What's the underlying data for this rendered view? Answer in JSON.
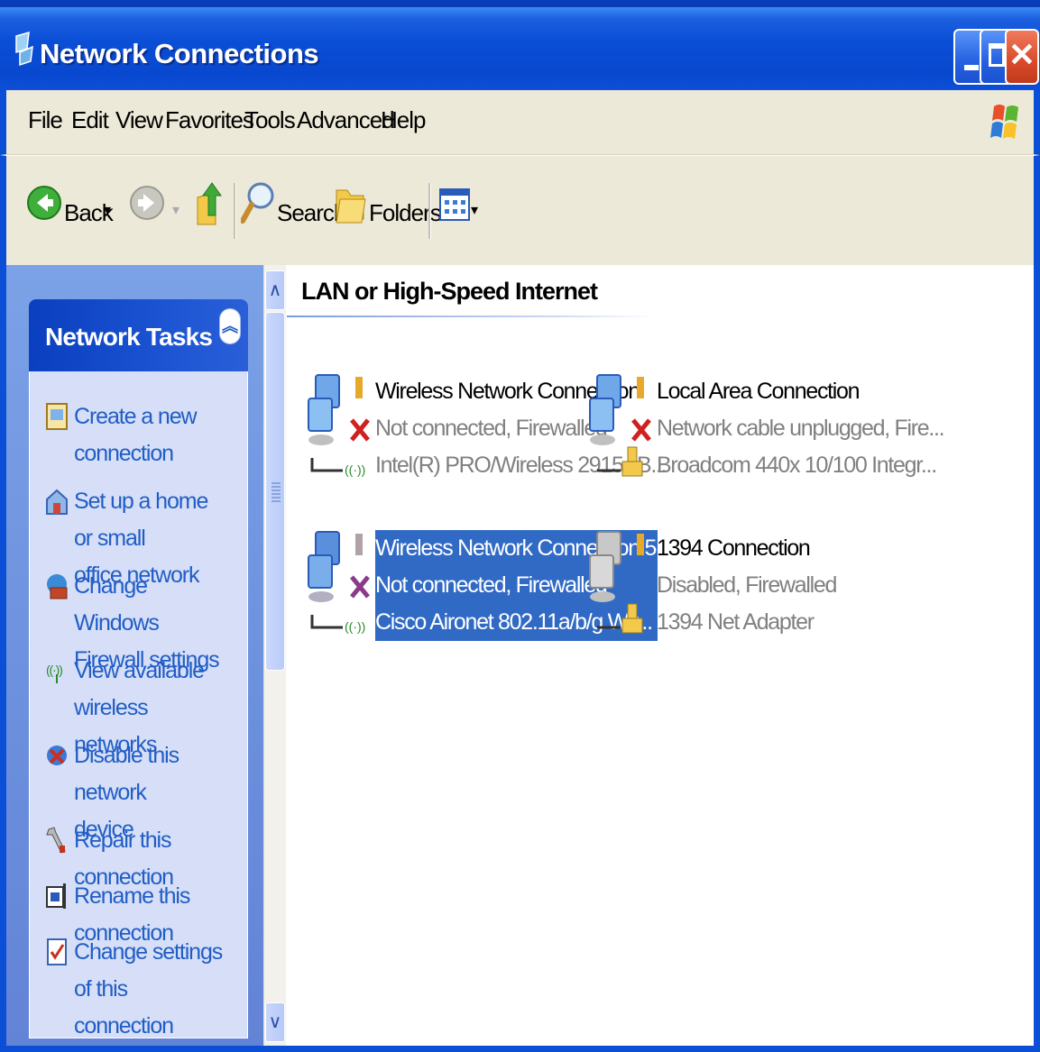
{
  "window": {
    "title": "Network Connections"
  },
  "menu": {
    "items": [
      "File",
      "Edit",
      "View",
      "Favorites",
      "Tools",
      "Advanced",
      "Help"
    ]
  },
  "toolbar": {
    "back_label": "Back",
    "search_label": "Search",
    "folders_label": "Folders"
  },
  "task_pane": {
    "title": "Network Tasks",
    "tasks": [
      {
        "line1": "Create a new",
        "line2": "connection",
        "icon": "new-connection-icon"
      },
      {
        "line1": "Set up a home or small",
        "line2": "office network",
        "icon": "home-network-icon"
      },
      {
        "line1": "Change Windows",
        "line2": "Firewall settings",
        "icon": "firewall-icon"
      },
      {
        "line1": "View available wireless",
        "line2": "networks",
        "icon": "wireless-icon"
      },
      {
        "line1": "Disable this network",
        "line2": "device",
        "icon": "disable-network-icon"
      },
      {
        "line1": "Repair this connection",
        "line2": "",
        "icon": "repair-icon"
      },
      {
        "line1": "Rename this connection",
        "line2": "",
        "icon": "rename-icon"
      },
      {
        "line1": "Change settings of this",
        "line2": "connection",
        "icon": "settings-icon"
      }
    ]
  },
  "content": {
    "group_title": "LAN or High-Speed Internet",
    "connections": [
      {
        "name": "Wireless Network Connection",
        "status": "Not connected, Firewalled",
        "device": "Intel(R) PRO/Wireless 2915AB...",
        "type": "wireless",
        "state": "disconnected",
        "selected": false
      },
      {
        "name": "Local Area Connection",
        "status": "Network cable unplugged, Fire...",
        "device": "Broadcom 440x 10/100 Integr...",
        "type": "lan",
        "state": "disconnected",
        "selected": false
      },
      {
        "name": "Wireless Network Connection 5",
        "status": "Not connected, Firewalled",
        "device": "Cisco Aironet 802.11a/b/g Wir...",
        "type": "wireless",
        "state": "disconnected",
        "selected": true
      },
      {
        "name": "1394 Connection",
        "status": "Disabled, Firewalled",
        "device": "1394 Net Adapter",
        "type": "lan",
        "state": "disabled",
        "selected": false
      }
    ]
  },
  "colors": {
    "titlebar": "#0a4fd6",
    "task_link": "#215dc6",
    "selection": "#316ac5",
    "status_gray": "#808080"
  }
}
